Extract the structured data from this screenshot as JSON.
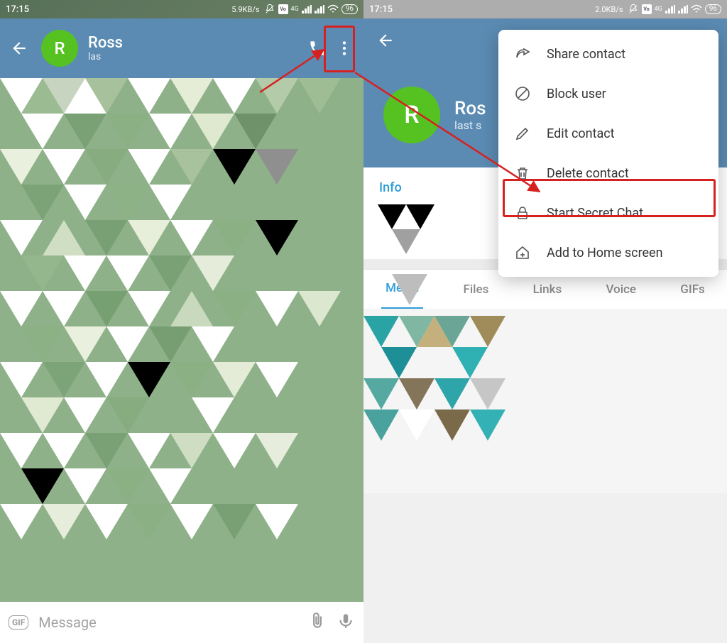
{
  "left": {
    "statusbar": {
      "time": "17:15",
      "speed": "5.9KB/s",
      "battery": "96"
    },
    "header": {
      "name": "Ross",
      "subtitle": "las",
      "avatar_letter": "R"
    },
    "composer": {
      "gif": "GIF",
      "placeholder": "Message"
    }
  },
  "right": {
    "statusbar": {
      "time": "17:15",
      "speed": "2.0KB/s",
      "battery": "96"
    },
    "profile": {
      "name": "Ros",
      "subtitle": "last s",
      "avatar_letter": "R"
    },
    "info_label": "Info",
    "toggle_on": true,
    "tabs": [
      "Media",
      "Files",
      "Links",
      "Voice",
      "GIFs"
    ],
    "active_tab": 0,
    "menu": {
      "items": [
        {
          "id": "share",
          "label": "Share contact"
        },
        {
          "id": "block",
          "label": "Block user"
        },
        {
          "id": "edit",
          "label": "Edit contact"
        },
        {
          "id": "delete",
          "label": "Delete contact"
        },
        {
          "id": "secret",
          "label": "Start Secret Chat"
        },
        {
          "id": "homescreen",
          "label": "Add to Home screen"
        }
      ]
    }
  },
  "annotation": {
    "highlights": [
      "more-menu-button",
      "menu-delete-contact"
    ],
    "colors": {
      "highlight": "#d62121"
    }
  }
}
